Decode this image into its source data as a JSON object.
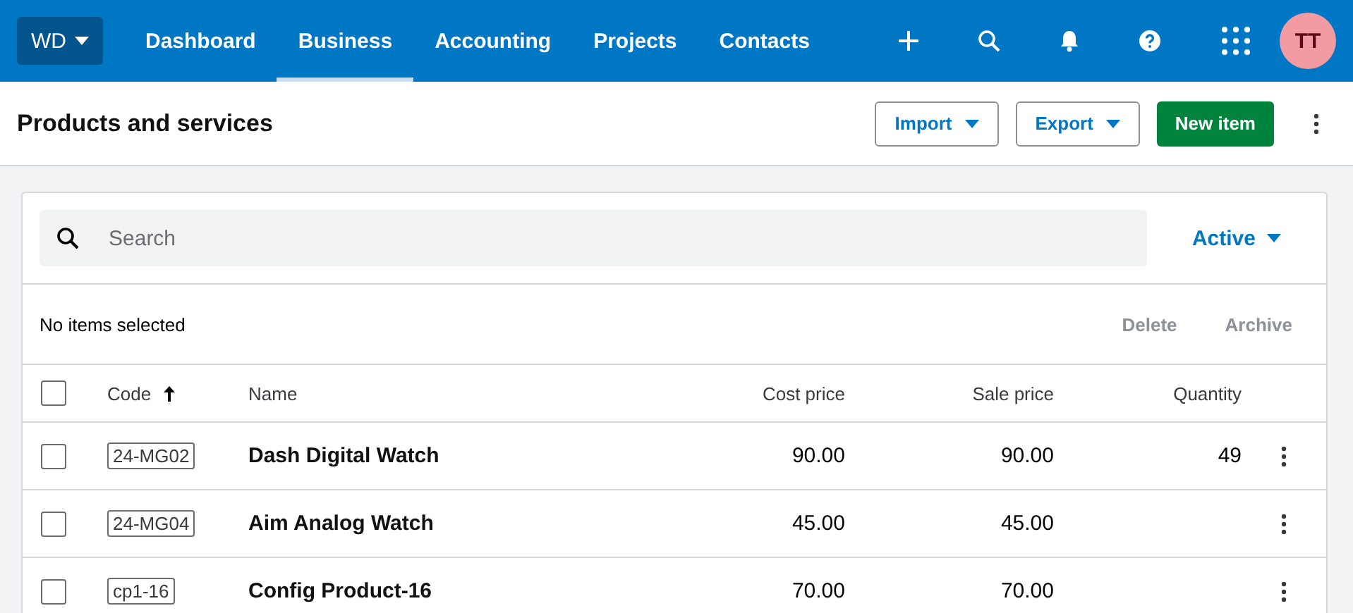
{
  "company_menu": {
    "label": "WD"
  },
  "nav": [
    {
      "label": "Dashboard",
      "selected": false
    },
    {
      "label": "Business",
      "selected": true
    },
    {
      "label": "Accounting",
      "selected": false
    },
    {
      "label": "Projects",
      "selected": false
    },
    {
      "label": "Contacts",
      "selected": false
    }
  ],
  "avatar": {
    "initials": "TT"
  },
  "page_title": "Products and services",
  "actions": [
    {
      "label": "Import",
      "kind": "dropdown"
    },
    {
      "label": "Export",
      "kind": "dropdown"
    },
    {
      "label": "New item",
      "kind": "primary"
    }
  ],
  "search": {
    "placeholder": "Search"
  },
  "status_filter": {
    "label": "Active"
  },
  "selection": {
    "text": "No items selected",
    "actions": [
      {
        "label": "Delete",
        "disabled": true
      },
      {
        "label": "Archive",
        "disabled": true
      }
    ]
  },
  "table": {
    "select_all_checked": false,
    "columns": [
      {
        "label": "Code",
        "sorted": true
      },
      {
        "label": "Name",
        "sorted": false
      },
      {
        "label": "Cost price",
        "sorted": false
      },
      {
        "label": "Sale price",
        "sorted": false
      },
      {
        "label": "Quantity",
        "sorted": false
      }
    ],
    "rows": [
      {
        "selected": false,
        "code": "24-MG02",
        "name": "Dash Digital Watch",
        "cost_price": "90.00",
        "sale_price": "90.00",
        "quantity": "49"
      },
      {
        "selected": false,
        "code": "24-MG04",
        "name": "Aim Analog Watch",
        "cost_price": "45.00",
        "sale_price": "45.00"
      },
      {
        "selected": false,
        "code": "cp1-16",
        "name": "Config Product-16",
        "cost_price": "70.00",
        "sale_price": "70.00"
      }
    ]
  }
}
